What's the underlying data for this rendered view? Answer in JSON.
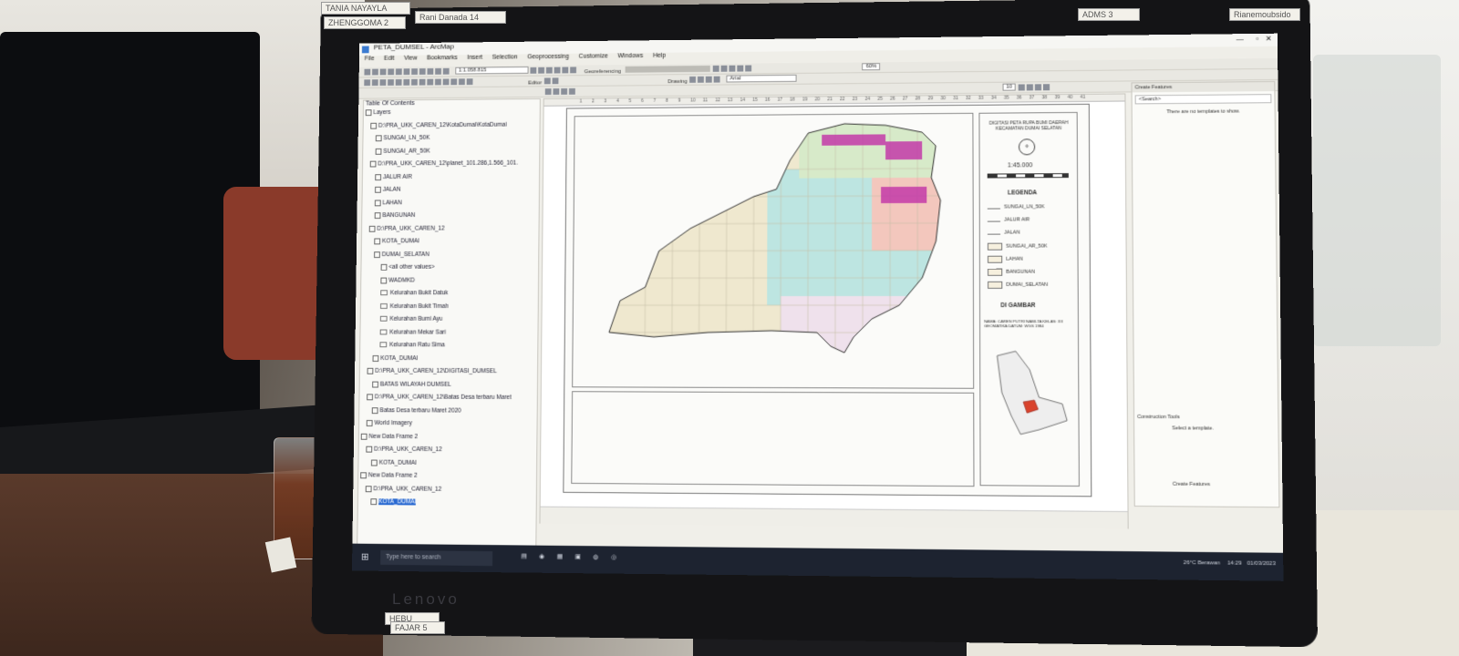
{
  "stickers": {
    "top_left_1": "TANIA NAYAYLA",
    "top_left_2": "ZHENGGOMA 2",
    "top_mid": "Rani Danada 14",
    "top_right_1": "ADMS 3",
    "top_right_2": "Rianemoubsido",
    "bottom_1": "HEBU",
    "bottom_2": "FAJAR 5"
  },
  "monitor_brand": "Lenovo",
  "window": {
    "title": "PETA_DUMSEL - ArcMap"
  },
  "menu": [
    "File",
    "Edit",
    "View",
    "Bookmarks",
    "Insert",
    "Selection",
    "Geoprocessing",
    "Customize",
    "Windows",
    "Help"
  ],
  "toolbar": {
    "scale": "1:1.058.815",
    "georeferencing": "Georeferencing",
    "editor": "Editor",
    "drawing": "Drawing",
    "font": "Arial",
    "font_size": "10",
    "zoom": "60%"
  },
  "toc": {
    "title": "Table Of Contents",
    "items": [
      "Layers",
      "D:\\PRA_UKK_CAREN_12\\KotaDumai\\KotaDumai",
      "SUNGAI_LN_50K",
      "SUNGAI_AR_50K",
      "D:\\PRA_UKK_CAREN_12\\planet_101.286,1.566_101.",
      "JALUR AIR",
      "JALAN",
      "LAHAN",
      "BANGUNAN",
      "D:\\PRA_UKK_CAREN_12",
      "KOTA_DUMAI",
      "DUMAI_SELATAN",
      "<all other values>",
      "WADMKD",
      "Kelurahan Bukit Datuk",
      "Kelurahan Bukit Timah",
      "Kelurahan Bumi Ayu",
      "Kelurahan Mekar Sari",
      "Kelurahan Ratu Sima",
      "KOTA_DUMAI",
      "D:\\PRA_UKK_CAREN_12\\DIGITASI_DUMSEL",
      "BATAS WILAYAH DUMSEL",
      "D:\\PRA_UKK_CAREN_12\\Batas Desa terbaru Maret",
      "Batas Desa terbaru Maret 2020",
      "World Imagery",
      "New Data Frame 2",
      "D:\\PRA_UKK_CAREN_12",
      "KOTA_DUMAI",
      "New Data Frame 2",
      "D:\\PRA_UKK_CAREN_12",
      "KOTA_DUMAI"
    ]
  },
  "layout": {
    "map_title": "DIGITASI PETA RUPA BUMI DAERAH KECAMATAN DUMAI SELATAN",
    "scale": "1:45.000",
    "legend_title": "LEGENDA",
    "legend_items": [
      "SUNGAI_LN_50K",
      "JALUR AIR",
      "JALAN",
      "SUNGAI_AR_50K",
      "LAHAN",
      "BANGUNAN",
      "DUMAI_SELATAN"
    ],
    "di_gambar": "DI GAMBAR",
    "author": "NAMA: CAREN PUTRI NABILTA KELAS: XII GEOMATIKA DATUM: WGS 1984",
    "ruler_ticks": [
      "1",
      "2",
      "3",
      "4",
      "5",
      "6",
      "7",
      "8",
      "9",
      "10",
      "11",
      "12",
      "13",
      "14",
      "15",
      "16",
      "17",
      "18",
      "19",
      "20",
      "21",
      "22",
      "23",
      "24",
      "25",
      "26",
      "27",
      "28",
      "29",
      "30",
      "31",
      "32",
      "33",
      "34",
      "35",
      "36",
      "37",
      "38",
      "39",
      "40",
      "41"
    ]
  },
  "create_features": {
    "title": "Create Features",
    "search_placeholder": "<Search>",
    "empty_text": "There are no templates to show.",
    "construction_tools": "Construction Tools",
    "select_template": "Select a template.",
    "footer": "Create Features"
  },
  "taskbar": {
    "search": "Type here to search",
    "weather": "26°C Berawan",
    "time": "14:29",
    "date": "01/03/2023"
  },
  "colors": {
    "accent": "#2d7bd6",
    "selection": "#2a6ad1"
  }
}
